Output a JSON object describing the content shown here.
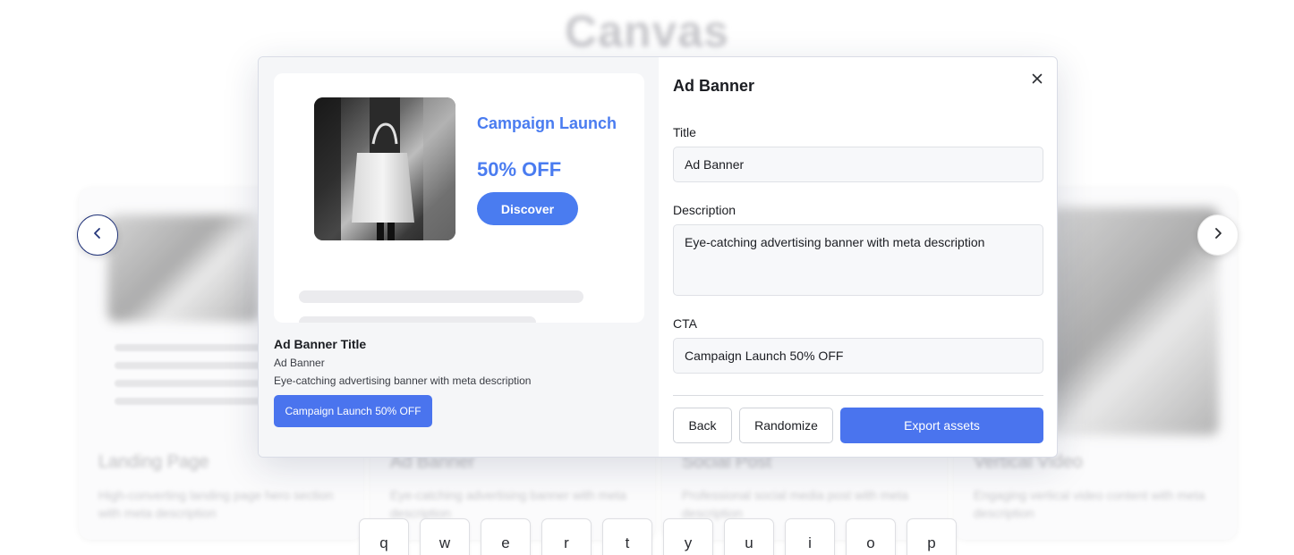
{
  "background": {
    "title": "Canvas",
    "cards": [
      {
        "title": "Landing Page",
        "description": "High-converting landing page hero section with meta description"
      },
      {
        "title": "Ad Banner",
        "description": "Eye-catching advertising banner with meta description"
      },
      {
        "title": "Social Post",
        "description": "Professional social media post with meta description"
      },
      {
        "title": "Vertical Video",
        "description": "Engaging vertical video content with meta description"
      }
    ]
  },
  "carousel": {
    "prev_icon": "chevron-left-icon",
    "next_icon": "chevron-right-icon"
  },
  "preview": {
    "headline": "Campaign Launch",
    "offer": "50% OFF",
    "button": "Discover"
  },
  "info": {
    "title": "Ad Banner Title",
    "subtitle": "Ad Banner",
    "description": "Eye-catching advertising banner with meta description",
    "cta": "Campaign Launch 50% OFF"
  },
  "form": {
    "heading": "Ad Banner",
    "title_label": "Title",
    "title_value": "Ad Banner",
    "description_label": "Description",
    "description_value": "Eye-catching advertising banner with meta description",
    "cta_label": "CTA",
    "cta_value": "Campaign Launch 50% OFF",
    "back": "Back",
    "randomize": "Randomize",
    "export": "Export assets"
  },
  "keyboard": [
    "q",
    "w",
    "e",
    "r",
    "t",
    "y",
    "u",
    "i",
    "o",
    "p"
  ],
  "colors": {
    "accent": "#4a74ee",
    "preview_blue": "#4a7cf0"
  }
}
